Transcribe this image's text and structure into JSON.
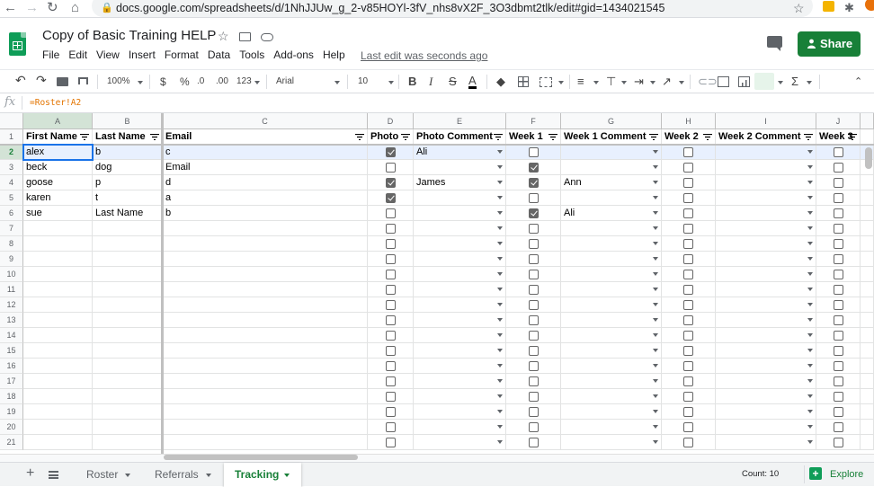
{
  "browser": {
    "url": "docs.google.com/spreadsheets/d/1NhJJUw_g_2-v85HOYl-3fV_nhs8vX2F_3O3dbmt2tlk/edit#gid=1434021545"
  },
  "app": {
    "title": "Copy of Basic Training HELP",
    "menu": [
      "File",
      "Edit",
      "View",
      "Insert",
      "Format",
      "Data",
      "Tools",
      "Add-ons",
      "Help"
    ],
    "last_edit": "Last edit was seconds ago",
    "share_label": "Share",
    "colors": {
      "accent": "#188038",
      "logo": "#0f9d58",
      "selection": "#1a73e8"
    }
  },
  "toolbar": {
    "zoom": "100%",
    "currency": "$",
    "percent": "%",
    "dec_less": ".0",
    "dec_more": ".00",
    "more_formats": "123",
    "font": "Arial",
    "font_size": "10",
    "bold": "B",
    "italic": "I",
    "strike": "S",
    "text_color": "A",
    "sum": "Σ"
  },
  "formula_bar": {
    "fx": "fx",
    "formula": "=Roster!A2"
  },
  "grid": {
    "col_letters": [
      "A",
      "B",
      "C",
      "D",
      "E",
      "F",
      "G",
      "H",
      "I",
      "J"
    ],
    "headers": [
      "First Name",
      "Last Name",
      "Email",
      "Photo",
      "Photo Comment",
      "Week 1",
      "Week 1 Comment",
      "Week 2",
      "Week 2 Comment",
      "Week 3"
    ],
    "row_numbers": [
      "1",
      "2",
      "3",
      "4",
      "5",
      "6",
      "7",
      "8",
      "9",
      "10",
      "11",
      "12",
      "13",
      "14",
      "15",
      "16",
      "17",
      "18",
      "19",
      "20",
      "21"
    ],
    "rows": [
      {
        "first": "alex",
        "last": "b",
        "email": "c",
        "photo": true,
        "photo_comment": "Ali",
        "week1": false,
        "week1_comment": "",
        "week2": false,
        "week2_comment": "",
        "week3": false
      },
      {
        "first": "beck",
        "last": "dog",
        "email": "Email",
        "photo": false,
        "photo_comment": "",
        "week1": true,
        "week1_comment": "",
        "week2": false,
        "week2_comment": "",
        "week3": false
      },
      {
        "first": "goose",
        "last": "p",
        "email": "d",
        "photo": true,
        "photo_comment": "James",
        "week1": true,
        "week1_comment": "Ann",
        "week2": false,
        "week2_comment": "",
        "week3": false
      },
      {
        "first": "karen",
        "last": "t",
        "email": "a",
        "photo": true,
        "photo_comment": "",
        "week1": false,
        "week1_comment": "",
        "week2": false,
        "week2_comment": "",
        "week3": false
      },
      {
        "first": "sue",
        "last": "Last Name",
        "email": "b",
        "photo": false,
        "photo_comment": "",
        "week1": true,
        "week1_comment": "Ali",
        "week2": false,
        "week2_comment": "",
        "week3": false
      }
    ],
    "empty_rows": 15,
    "selected_cell": "A2"
  },
  "sheets": {
    "tabs": [
      "Roster",
      "Referrals",
      "Tracking"
    ],
    "active": "Tracking",
    "count": "Count: 10",
    "explore_label": "Explore"
  }
}
